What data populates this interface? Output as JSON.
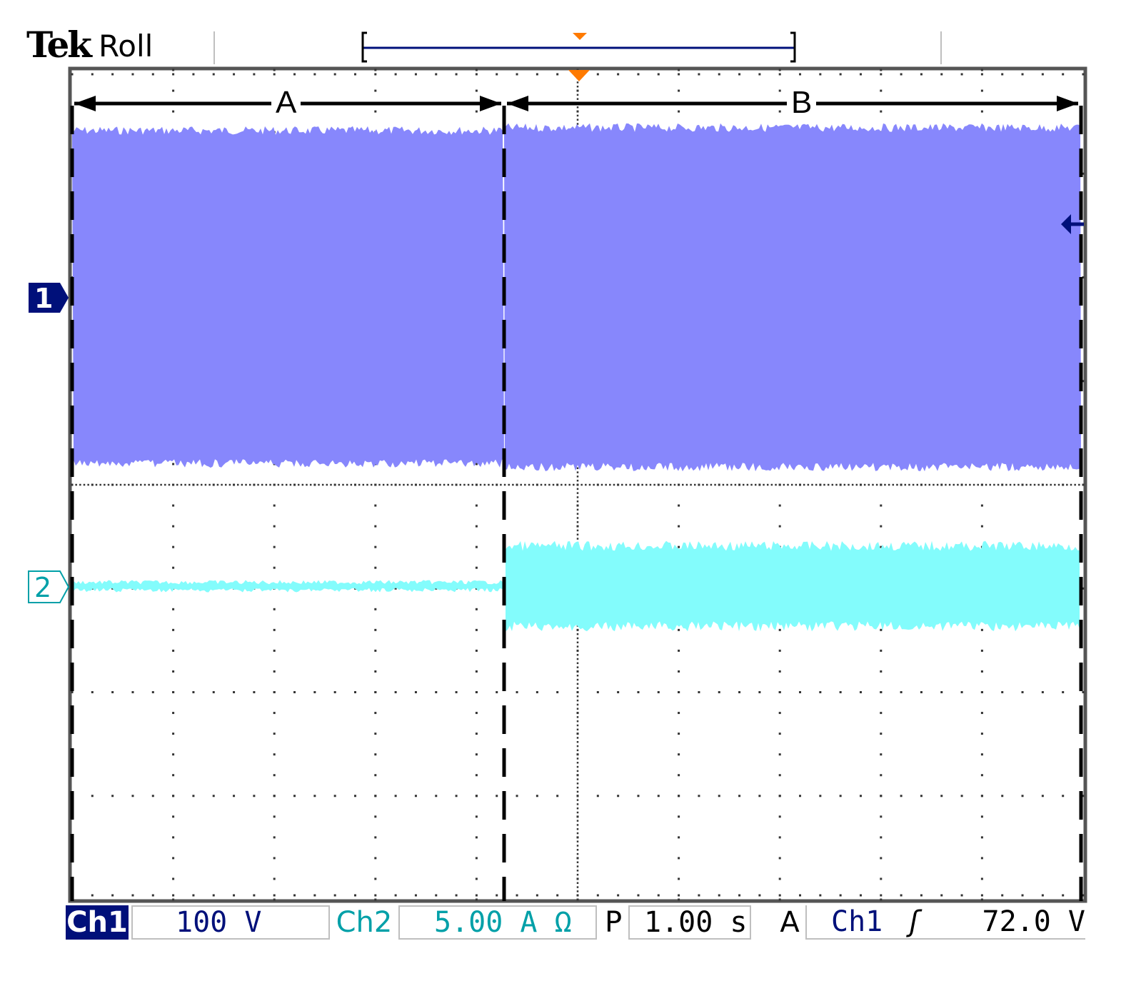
{
  "header": {
    "brand": "Tek",
    "mode": "Roll"
  },
  "regions": {
    "a_label": "A",
    "b_label": "B"
  },
  "channel_markers": {
    "ch1": "1",
    "ch2": "2"
  },
  "status_bar": {
    "ch1_label": "Ch1",
    "ch1_scale": "100 V",
    "ch2_label": "Ch2",
    "ch2_scale": "5.00 A Ω",
    "p_label": "P",
    "timebase": "1.00 s",
    "a_label": "A",
    "trigger_source": "Ch1",
    "trigger_level": "72.0 V"
  },
  "colors": {
    "ch1_trace": "#8787fc",
    "ch2_trace": "#83fcfc",
    "ch1_marker": "#00107a",
    "ch2_marker": "#00a0a8",
    "trigger_marker": "#ff7a00"
  }
}
